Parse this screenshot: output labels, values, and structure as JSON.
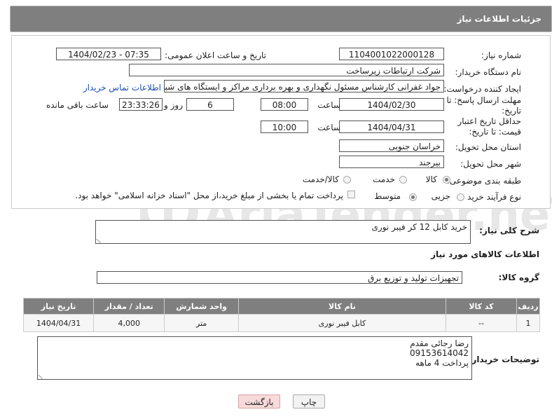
{
  "header": {
    "title": "جزئیات اطلاعات نیاز"
  },
  "form": {
    "need_number_label": "شماره نیاز:",
    "need_number": "1104001022000128",
    "announce_label": "تاریخ و ساعت اعلان عمومی:",
    "announce_value": "1404/02/23 - 07:35",
    "buyer_org_label": "نام دستگاه خریدار:",
    "buyer_org": "شرکت ارتباطات زیرساخت",
    "requester_label": "ایجاد کننده درخواست:",
    "requester": "جواد غفرانی کارشناس مسئول نگهداری و بهره برداری مراکز و ایستگاه های شبکه",
    "contact_link": "اطلاعات تماس خریدار",
    "deadline_label": "مهلت ارسال پاسخ: تا تاریخ:",
    "deadline_date": "1404/02/30",
    "time_label": "ساعت",
    "deadline_time": "08:00",
    "days_value": "6",
    "days_label": "روز و",
    "remaining_time": "23:33:26",
    "remaining_label": "ساعت باقی مانده",
    "validity_label": "حداقل تاریخ اعتبار قیمت: تا تاریخ:",
    "validity_date": "1404/04/31",
    "validity_time": "10:00",
    "province_label": "استان محل تحویل:",
    "province": "خراسان جنوبی",
    "city_label": "شهر محل تحویل:",
    "city": "بیرجند",
    "category_label": "طبقه بندی موضوعی:",
    "category_options": [
      "کالا",
      "خدمت",
      "کالا/خدمت"
    ],
    "process_label": "نوع فرآیند خرید :",
    "process_options": [
      "جزیی",
      "متوسط"
    ],
    "payment_note": "پرداخت تمام یا بخشی از مبلغ خرید،از محل \"اسناد خزانه اسلامی\" خواهد بود."
  },
  "summary": {
    "label": "شرح کلی نیاز:",
    "value": "خرید کابل 12 کر فیبر نوری"
  },
  "goods": {
    "section_title": "اطلاعات کالاهای مورد نیاز",
    "group_label": "گروه کالا:",
    "group_value": "تجهیزات تولید و توزیع برق"
  },
  "table": {
    "headers": [
      "ردیف",
      "کد کالا",
      "نام کالا",
      "واحد شمارش",
      "تعداد / مقدار",
      "تاریخ نیاز"
    ],
    "rows": [
      [
        "1",
        "--",
        "کابل فیبر نوری",
        "متر",
        "4,000",
        "1404/04/31"
      ]
    ]
  },
  "notes": {
    "label": "توضیحات خریدار:",
    "lines": [
      "رضا رجائی مقدم",
      "09153614042",
      "پرداخت 4 ماهه"
    ]
  },
  "buttons": {
    "print": "چاپ",
    "back": "بازگشت"
  },
  "watermark": {
    "text": "AriaTender.neT"
  }
}
